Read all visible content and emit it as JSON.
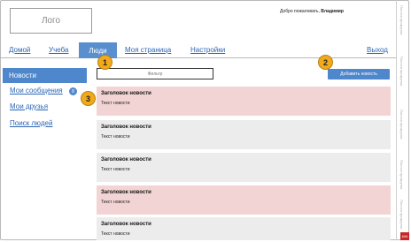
{
  "header": {
    "logo_text": "Лого",
    "welcome_prefix": "Добро пожаловать, ",
    "welcome_user": "Владимир"
  },
  "topnav": {
    "items": [
      {
        "label": "Домой"
      },
      {
        "label": "Учеба"
      },
      {
        "label": "Люди"
      },
      {
        "label": "Моя страница"
      },
      {
        "label": "Настройки"
      }
    ],
    "logout": "Выход"
  },
  "sidebar": {
    "items": [
      {
        "label": "Новости"
      },
      {
        "label": "Мои сообщения",
        "badge": "8"
      },
      {
        "label": "Мои друзья"
      },
      {
        "label": "Поиск людей"
      }
    ]
  },
  "toolbar": {
    "filter_placeholder": "Фильтр",
    "add_news_label": "Добавить новость"
  },
  "news": [
    {
      "title": "Заголовок новости",
      "text": "Текст новости",
      "highlight": true
    },
    {
      "title": "Заголовок новости",
      "text": "Текст новости",
      "highlight": false
    },
    {
      "title": "Заголовок новости",
      "text": "Текст новости",
      "highlight": false
    },
    {
      "title": "Заголовок новости",
      "text": "Текст новости",
      "highlight": true
    },
    {
      "title": "Заголовок новости",
      "text": "Текст новости",
      "highlight": false
    }
  ],
  "markers": [
    "1",
    "2",
    "3"
  ],
  "rail": {
    "labels": [
      "Полоса прокрутки",
      "Полоса прокрутки",
      "Полоса прокрутки",
      "Полоса прокрутки",
      "Полоса прокрутки"
    ],
    "corner_badge": "606"
  },
  "colors": {
    "accent": "#4f87cc",
    "highlight_row": "#f2d4d4",
    "normal_row": "#ececec",
    "marker": "#f2a91a"
  }
}
